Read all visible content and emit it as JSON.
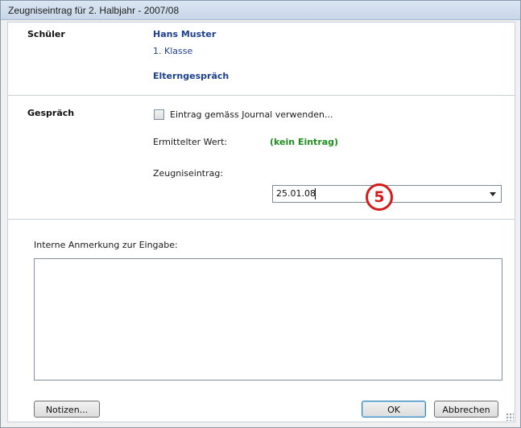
{
  "window": {
    "title": "Zeugniseintrag für 2. Halbjahr - 2007/08"
  },
  "student": {
    "section_label": "Schüler",
    "name": "Hans Muster",
    "class": "1. Klasse",
    "subject": "Elterngespräch"
  },
  "conversation": {
    "section_label": "Gespräch",
    "checkbox_label": "Eintrag gemäss Journal verwenden...",
    "checkbox_checked": false,
    "determined_label": "Ermittelter Wert:",
    "determined_value": "(kein Eintrag)",
    "entry_label": "Zeugniseintrag:",
    "entry_value": "25.01.08",
    "step_badge": "5"
  },
  "remarks": {
    "label": "Interne Anmerkung zur Eingabe:",
    "value": ""
  },
  "buttons": {
    "notes": "Notizen...",
    "ok": "OK",
    "cancel": "Abbrechen"
  },
  "colors": {
    "accent_blue": "#1d3f8c",
    "value_green": "#1e8f1e",
    "badge_red": "#d41c1c"
  }
}
